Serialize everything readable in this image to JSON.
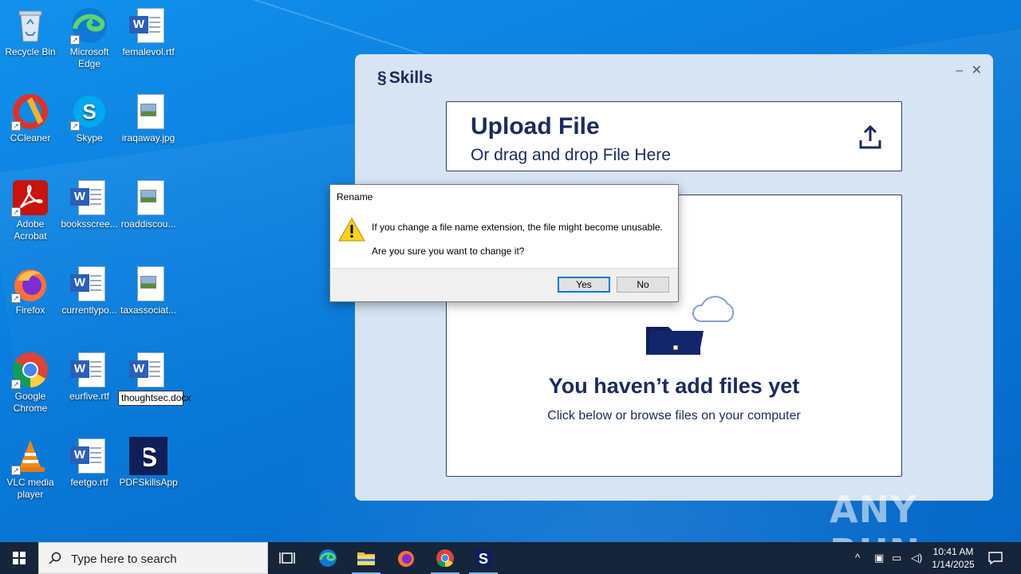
{
  "desktop": {
    "icons": [
      {
        "label": "Recycle Bin"
      },
      {
        "label": "Microsoft Edge"
      },
      {
        "label": "femalevol.rtf"
      },
      {
        "label": "CCleaner"
      },
      {
        "label": "Skype"
      },
      {
        "label": "iraqaway.jpg"
      },
      {
        "label": "Adobe Acrobat"
      },
      {
        "label": "booksscree..."
      },
      {
        "label": "roaddiscou..."
      },
      {
        "label": "Firefox"
      },
      {
        "label": "currentlypo..."
      },
      {
        "label": "taxassociat..."
      },
      {
        "label": "Google Chrome"
      },
      {
        "label": "eurfive.rtf"
      },
      {
        "label": "thoughtsec.docx"
      },
      {
        "label": "VLC media player"
      },
      {
        "label": "feetgo.rtf"
      },
      {
        "label": "PDFSkillsApp"
      }
    ]
  },
  "app": {
    "logo": "Skills",
    "minimize": "–",
    "close": "✕",
    "upload_title": "Upload File",
    "upload_sub": "Or drag and drop File Here",
    "empty_title": "You haven’t add files yet",
    "empty_sub": "Click below or browse files on your computer"
  },
  "dialog": {
    "title": "Rename",
    "message1": "If you change a file name extension, the file might become unusable.",
    "message2": "Are you sure you want to change it?",
    "yes": "Yes",
    "no": "No"
  },
  "taskbar": {
    "search_placeholder": "Type here to search",
    "time": "10:41 AM",
    "date": "1/14/2025"
  },
  "watermark": "ANY RUN",
  "colors": {
    "brand_navy": "#1a2b5c",
    "taskbar": "#16253a",
    "accent": "#0078d7"
  }
}
